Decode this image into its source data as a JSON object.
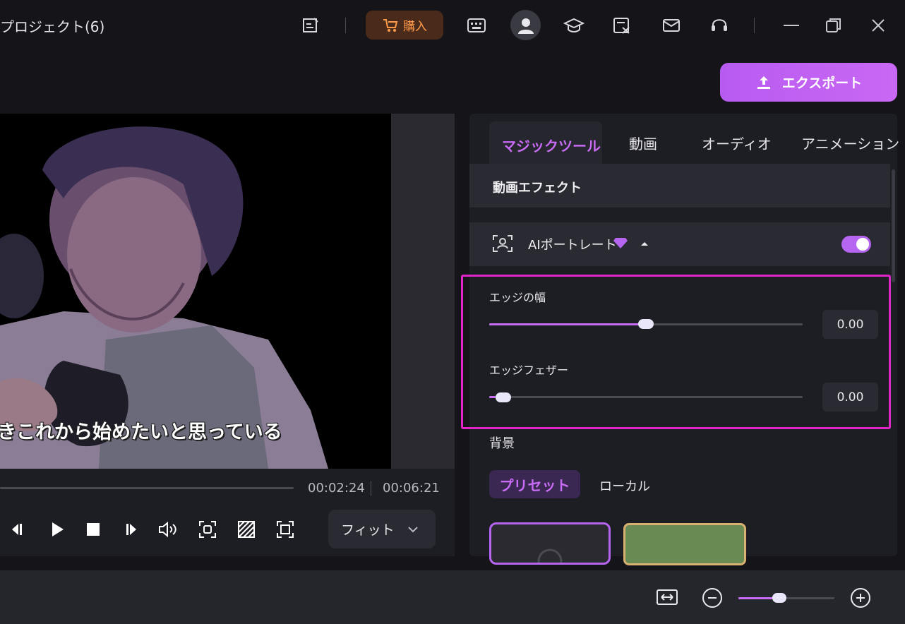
{
  "window": {
    "title": "プロジェクト(6)",
    "buy_label": "購入"
  },
  "export": {
    "label": "エクスポート"
  },
  "preview": {
    "subtitle": "きこれから始めたいと思っている",
    "current_time": "00:02:24",
    "total_time": "00:06:21",
    "fit_label": "フィット"
  },
  "props": {
    "tabs": [
      "マジックツール",
      "動画",
      "オーディオ",
      "アニメーション"
    ],
    "active_tab_index": 0,
    "section_title": "動画エフェクト",
    "ai_portrait": {
      "label": "AIポートレート",
      "enabled": true
    },
    "edge_width": {
      "label": "エッジの幅",
      "value": "0.00",
      "slider_fraction": 0.5
    },
    "edge_feather": {
      "label": "エッジフェザー",
      "value": "0.00",
      "slider_fraction": 0.02
    },
    "background": {
      "label": "背景",
      "tabs": [
        "プリセット",
        "ローカル"
      ]
    }
  },
  "timeline": {
    "zoom_fraction": 0.43
  },
  "colors": {
    "accent": "#c86cf5",
    "highlight_border": "#e026c8",
    "buy": "#ff9a4a"
  }
}
